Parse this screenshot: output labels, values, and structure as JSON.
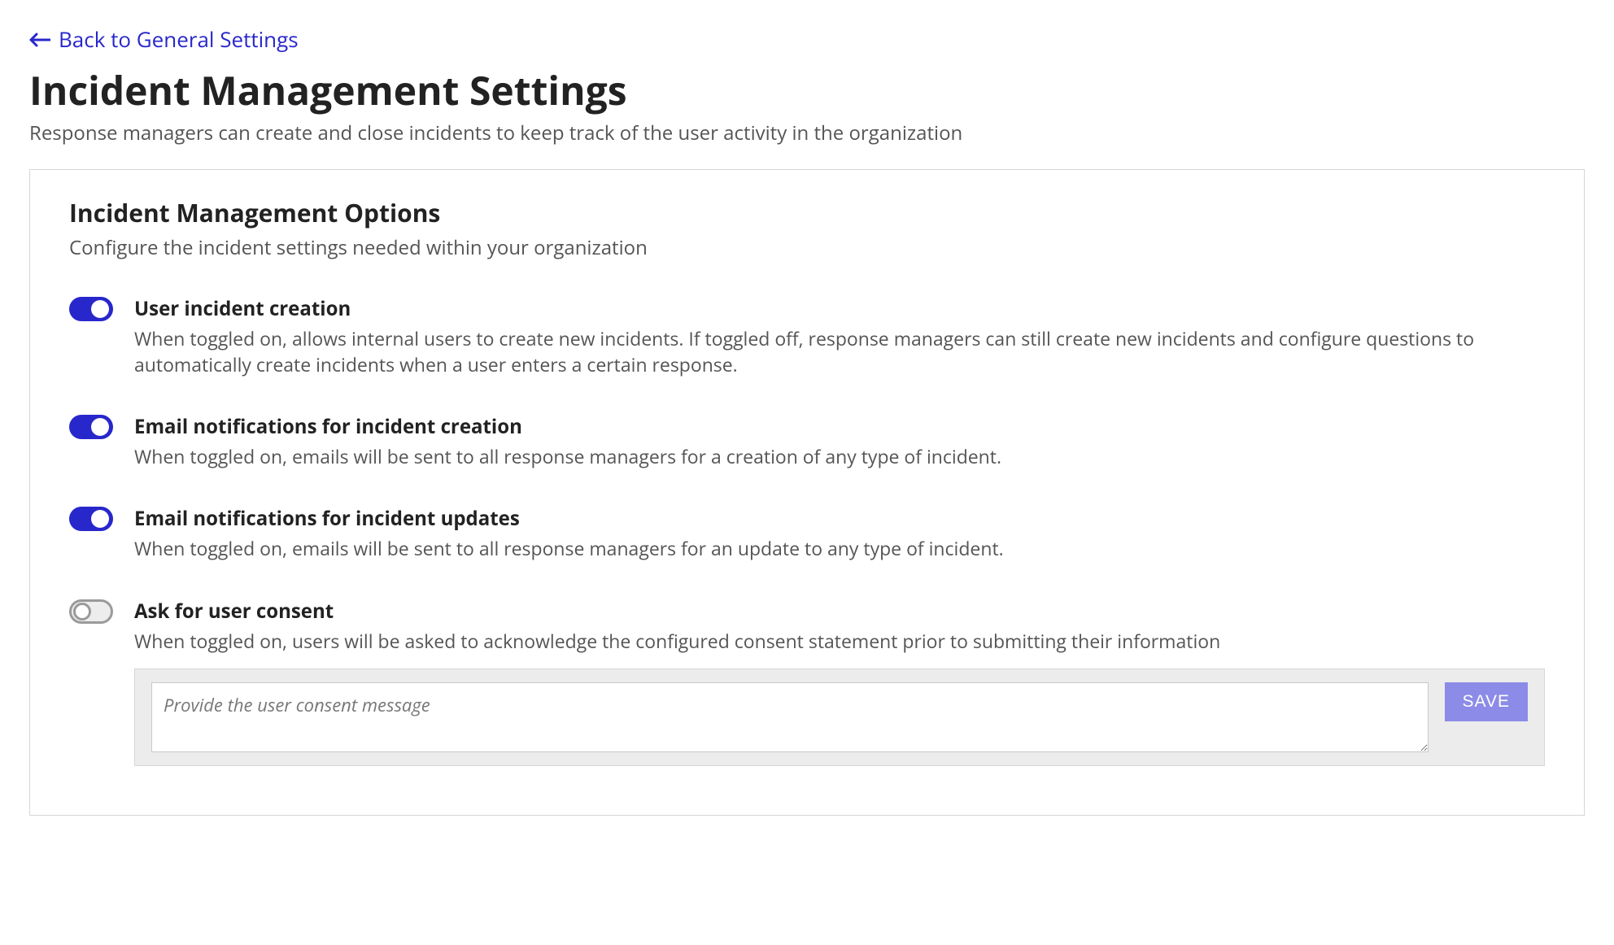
{
  "back_link": {
    "label": "Back to General Settings"
  },
  "page": {
    "title": "Incident Management Settings",
    "subtitle": "Response managers can create and close incidents to keep track of the user activity in the organization"
  },
  "panel": {
    "title": "Incident Management Options",
    "subtitle": "Configure the incident settings needed within your organization"
  },
  "options": {
    "user_incident_creation": {
      "title": "User incident creation",
      "desc": "When toggled on, allows internal users to create new incidents. If toggled off, response managers can still create new incidents and configure questions to automatically create incidents when a user enters a certain response.",
      "on": true
    },
    "email_creation": {
      "title": "Email notifications for incident creation",
      "desc": "When toggled on, emails will be sent to all response managers for a creation of any type of incident.",
      "on": true
    },
    "email_updates": {
      "title": "Email notifications for incident updates",
      "desc": "When toggled on, emails will be sent to all response managers for an update to any type of incident.",
      "on": true
    },
    "user_consent": {
      "title": "Ask for user consent",
      "desc": "When toggled on, users will be asked to acknowledge the configured consent statement prior to submitting their information",
      "on": false,
      "placeholder": "Provide the user consent message",
      "save_label": "SAVE"
    }
  }
}
